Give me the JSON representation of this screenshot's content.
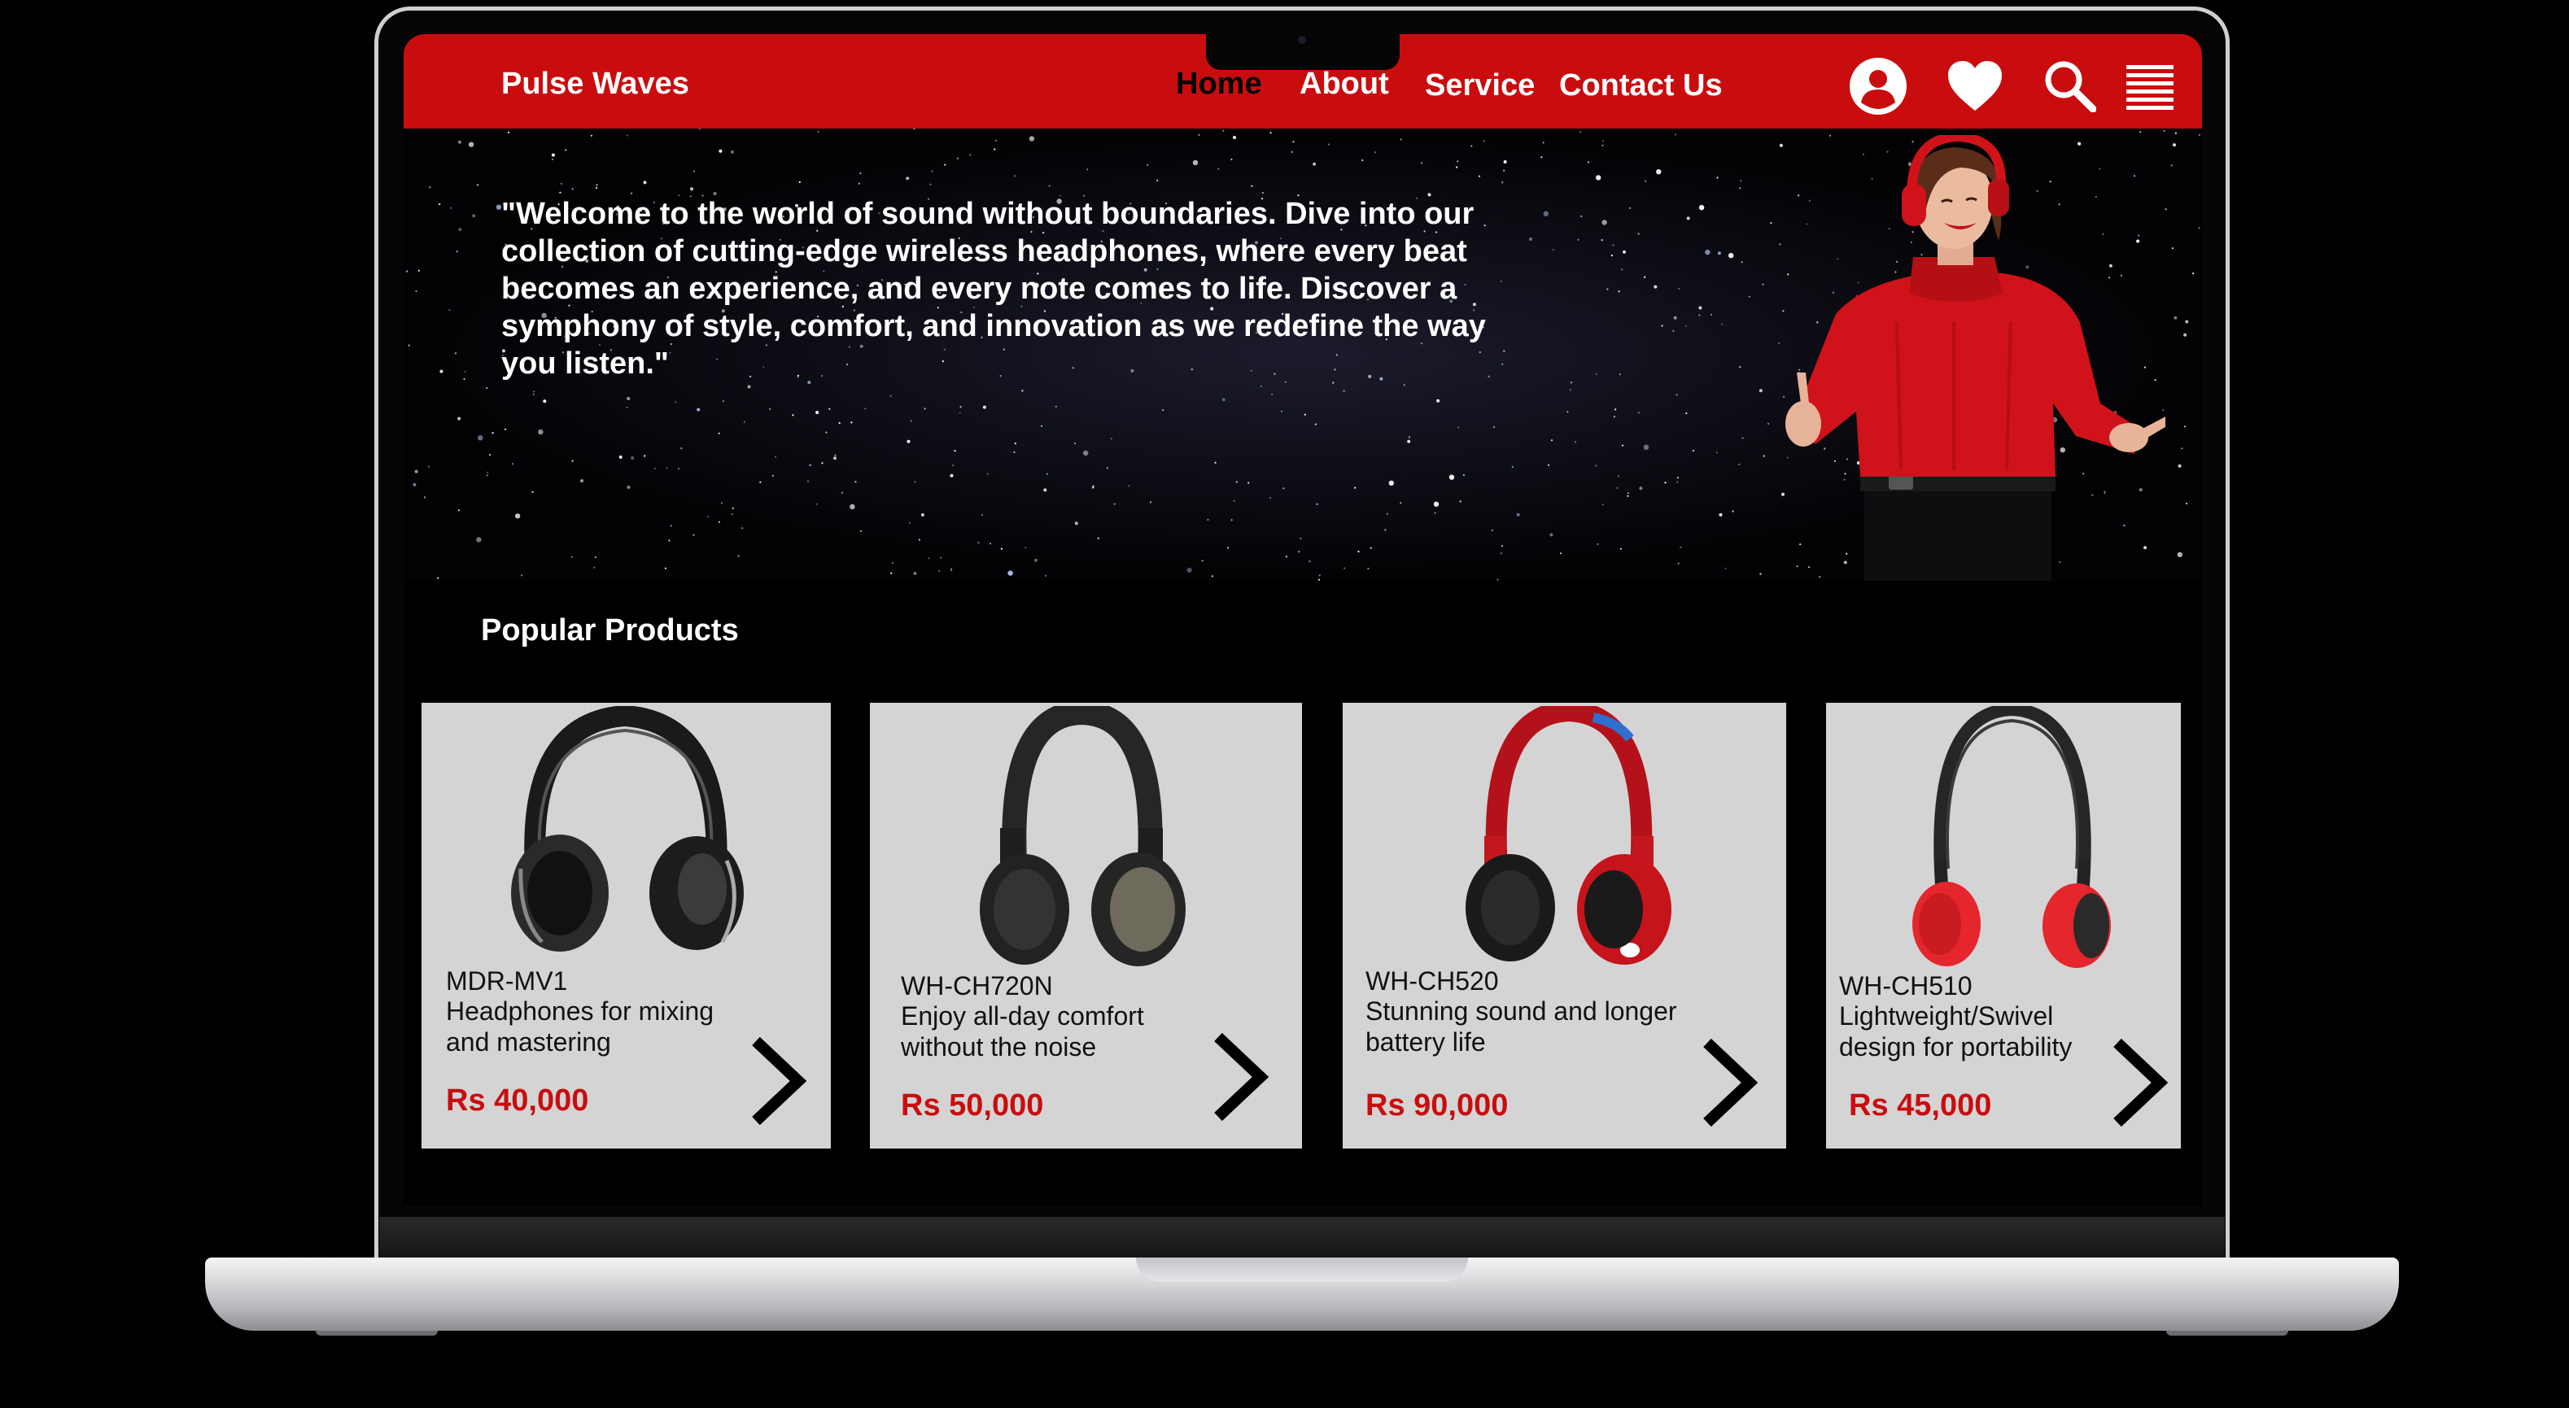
{
  "brand": "Pulse Waves",
  "nav": {
    "home": "Home",
    "about": "About",
    "service": "Service",
    "contact": "Contact Us"
  },
  "icons": {
    "account": "user-circle-icon",
    "wishlist": "heart-icon",
    "search": "search-icon",
    "menu": "menu-icon"
  },
  "hero": {
    "lines": [
      "\"Welcome to the world of sound without boundaries. Dive into our",
      "collection of cutting-edge wireless headphones, where every beat",
      "becomes an experience, and every note comes to life. Discover a",
      "symphony of style, comfort, and innovation as we redefine the way",
      "you listen.\""
    ]
  },
  "section_title": "Popular Products",
  "products": [
    {
      "model": "MDR-MV1",
      "desc1": "Headphones for mixing",
      "desc2": "and mastering",
      "price": "Rs 40,000",
      "color": "black"
    },
    {
      "model": "WH-CH720N",
      "desc1": "Enjoy all-day comfort",
      "desc2": "without the noise",
      "price": "Rs 50,000",
      "color": "dark-grey"
    },
    {
      "model": "WH-CH520",
      "desc1": "Stunning sound and longer",
      "desc2": "battery life",
      "price": "Rs 90,000",
      "color": "red"
    },
    {
      "model": "WH-CH510",
      "desc1": "Lightweight/Swivel",
      "desc2": "design for portability",
      "price": "Rs 45,000",
      "color": "black-red"
    }
  ],
  "colors": {
    "accent": "#c90d0f",
    "card_bg": "#d4d4d4",
    "page_bg": "#000000"
  }
}
